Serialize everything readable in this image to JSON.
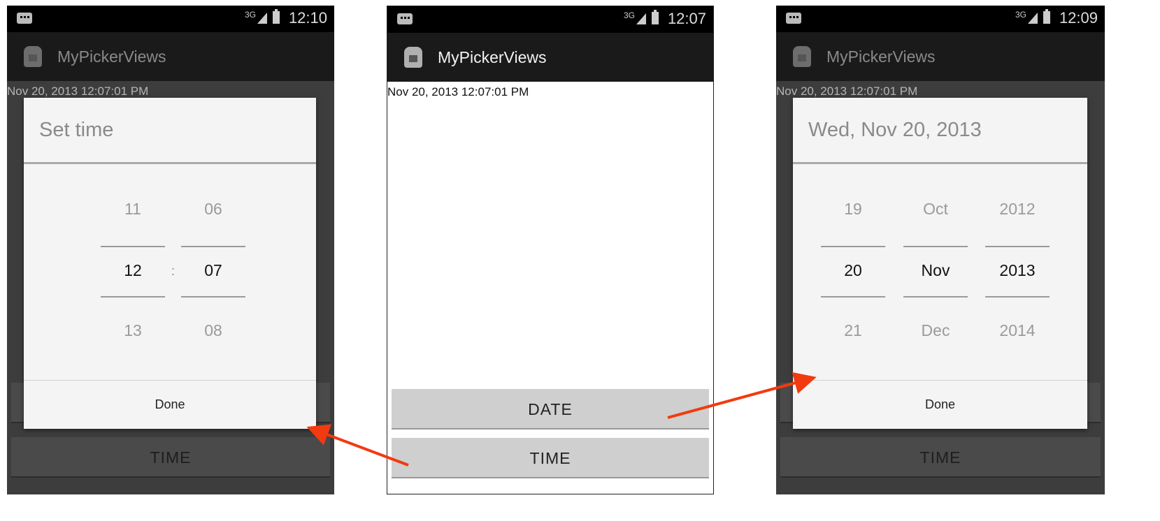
{
  "colors": {
    "arrow": "#f23a10",
    "button": "#cfcfcf",
    "dialog": "#f4f4f4"
  },
  "left": {
    "clock": "12:10",
    "net": "3G",
    "app_title": "MyPickerViews",
    "datetime": "Nov 20, 2013 12:07:01 PM",
    "time_button": "TIME",
    "dialog": {
      "title": "Set time",
      "hour": {
        "prev": "11",
        "cur": "12",
        "next": "13"
      },
      "separator": ":",
      "minute": {
        "prev": "06",
        "cur": "07",
        "next": "08"
      },
      "done": "Done"
    }
  },
  "middle": {
    "clock": "12:07",
    "net": "3G",
    "app_title": "MyPickerViews",
    "datetime": "Nov 20, 2013 12:07:01 PM",
    "date_button": "DATE",
    "time_button": "TIME"
  },
  "right": {
    "clock": "12:09",
    "net": "3G",
    "app_title": "MyPickerViews",
    "datetime": "Nov 20, 2013 12:07:01 PM",
    "time_button": "TIME",
    "dialog": {
      "title": "Wed, Nov 20, 2013",
      "day": {
        "prev": "19",
        "cur": "20",
        "next": "21"
      },
      "month": {
        "prev": "Oct",
        "cur": "Nov",
        "next": "Dec"
      },
      "year": {
        "prev": "2012",
        "cur": "2013",
        "next": "2014"
      },
      "done": "Done"
    }
  }
}
